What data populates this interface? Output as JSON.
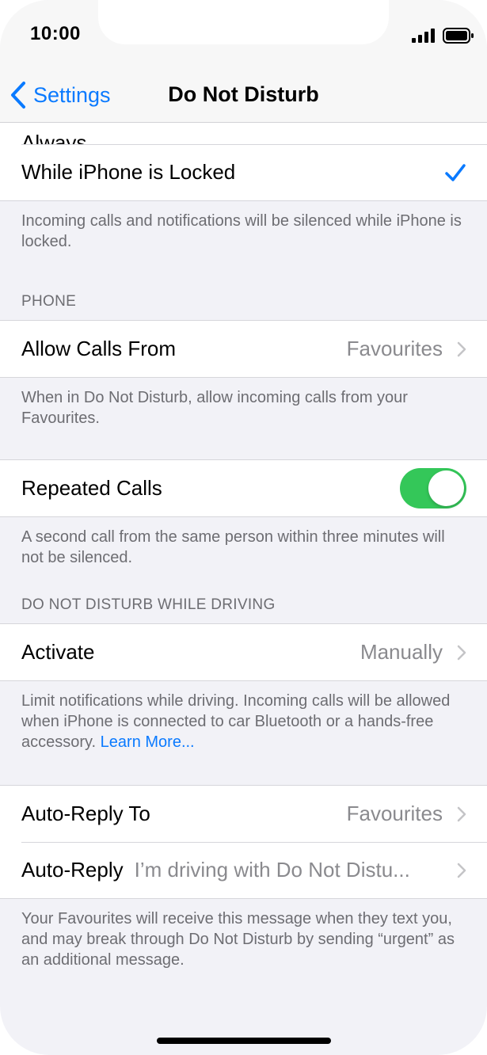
{
  "status_bar": {
    "time": "10:00"
  },
  "nav": {
    "back_label": "Settings",
    "title": "Do Not Disturb"
  },
  "silence": {
    "partial_row_label": "Always",
    "locked_row_label": "While iPhone is Locked",
    "footer": "Incoming calls and notifications will be silenced while iPhone is locked."
  },
  "phone_section": {
    "header": "PHONE",
    "allow_calls_label": "Allow Calls From",
    "allow_calls_value": "Favourites",
    "allow_calls_footer": "When in Do Not Disturb, allow incoming calls from your Favourites.",
    "repeated_calls_label": "Repeated Calls",
    "repeated_calls_on": true,
    "repeated_calls_footer": "A second call from the same person within three minutes will not be silenced."
  },
  "driving_section": {
    "header": "DO NOT DISTURB WHILE DRIVING",
    "activate_label": "Activate",
    "activate_value": "Manually",
    "activate_footer": "Limit notifications while driving. Incoming calls will be allowed when iPhone is connected to car Bluetooth or a hands-free accessory.",
    "learn_more": "Learn More...",
    "auto_reply_to_label": "Auto-Reply To",
    "auto_reply_to_value": "Favourites",
    "auto_reply_label": "Auto-Reply",
    "auto_reply_value": "I’m driving with Do Not Distu...",
    "auto_reply_footer": "Your Favourites will receive this message when they text you, and may break through Do Not Disturb by sending “urgent” as an additional message."
  },
  "colors": {
    "accent": "#0a7aff",
    "toggle_on": "#34c759",
    "background": "#f2f2f7"
  },
  "icons": [
    "signal-icon",
    "battery-icon",
    "back-chevron-icon",
    "checkmark-icon",
    "chevron-right-icon"
  ]
}
